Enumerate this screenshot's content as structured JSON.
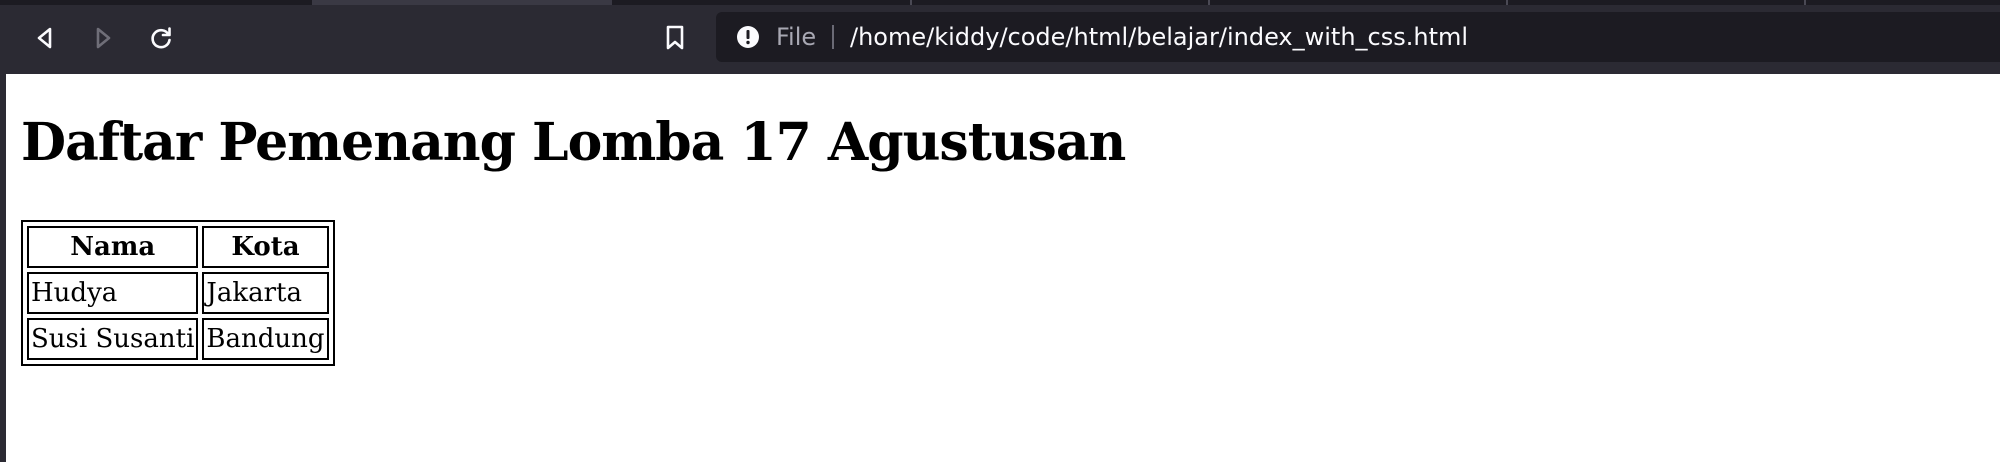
{
  "browser": {
    "address_bar": {
      "security_label": "File",
      "url": "/home/kiddy/code/html/belajar/index_with_css.html"
    },
    "colors": {
      "chrome_bg": "#2b2a33",
      "urlbar_bg": "#1c1b22",
      "url_text": "#fbfbfe"
    }
  },
  "page": {
    "title": "Daftar Pemenang Lomba 17 Agustusan",
    "table": {
      "headers": [
        "Nama",
        "Kota"
      ],
      "rows": [
        [
          "Hudya",
          "Jakarta"
        ],
        [
          "Susi Susanti",
          "Bandung"
        ]
      ]
    }
  }
}
